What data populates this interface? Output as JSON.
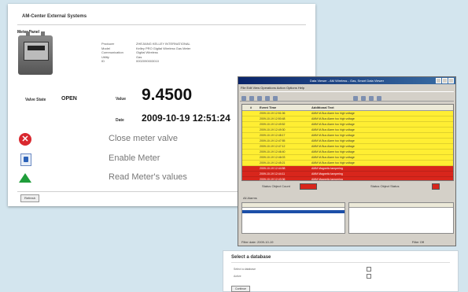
{
  "meter_window": {
    "title": "AM-Center External Systems",
    "panel_title": "Meter Panel",
    "info": [
      {
        "label": "Producer",
        "value": "ZHEJIANG KELLEY INTERNATIONAL"
      },
      {
        "label": "Model",
        "value": "Kelley PRO Gigital Wireless Gas Meter"
      },
      {
        "label": "Communication",
        "value": "Gigital Wireless"
      },
      {
        "label": "Utility",
        "value": "Gas"
      },
      {
        "label": "ID",
        "value": "0002090003010"
      }
    ],
    "valve_state_label": "Valve State",
    "valve_state_value": "OPEN",
    "value_label": "Value",
    "value": "9.4500",
    "date_label": "Date",
    "date_value": "2009-10-19 12:51:24",
    "actions": [
      {
        "label": "Close meter valve",
        "icon": "close-valve-icon"
      },
      {
        "label": "Enable Meter",
        "icon": "enable-meter-icon"
      },
      {
        "label": "Read Meter's values",
        "icon": "read-values-icon"
      }
    ],
    "refresh_label": "Refresh"
  },
  "log_window": {
    "title": "Data Viewer - AM Wireless - Gas, Smart Data Viewer",
    "menu": "File  Edit  View  Operations  Action  Options  Help",
    "columns": [
      "#",
      "Event Time",
      "Additional Text"
    ],
    "rows": [
      {
        "time": "2009-10-19 12:51:06",
        "text": "AMM M-Bus Alarm too high voltage",
        "color": "y"
      },
      {
        "time": "2009-10-19 12:50:48",
        "text": "AMM M-Bus Alarm too high voltage",
        "color": "y"
      },
      {
        "time": "2009-10-19 12:49:52",
        "text": "AMM M-Bus Alarm too high voltage",
        "color": "y"
      },
      {
        "time": "2009-10-19 12:49:30",
        "text": "AMM M-Bus Alarm too high voltage",
        "color": "y"
      },
      {
        "time": "2009-10-19 12:48:17",
        "text": "AMM M-Bus Alarm too high voltage",
        "color": "y"
      },
      {
        "time": "2009-10-19 12:47:55",
        "text": "AMM M-Bus Alarm too high voltage",
        "color": "y"
      },
      {
        "time": "2009-10-19 12:47:12",
        "text": "AMM M-Bus Alarm too high voltage",
        "color": "y"
      },
      {
        "time": "2009-10-19 12:46:40",
        "text": "AMM M-Bus Alarm too high voltage",
        "color": "y"
      },
      {
        "time": "2009-10-19 12:46:03",
        "text": "AMM M-Bus Alarm too high voltage",
        "color": "y"
      },
      {
        "time": "2009-10-19 12:45:21",
        "text": "AMM M-Bus Alarm too high voltage",
        "color": "y"
      },
      {
        "time": "2009-10-19 12:44:58",
        "text": "AMM Magnetic tampering",
        "color": "r"
      },
      {
        "time": "2009-10-19 12:44:11",
        "text": "AMM Magnetic tampering",
        "color": "r"
      },
      {
        "time": "2009-10-19 12:43:36",
        "text": "AMM Magnetic tampering",
        "color": "r"
      },
      {
        "time": "",
        "text": "",
        "color": "w"
      }
    ],
    "status_left_label": "Status Object Count",
    "status_right_label": "Status Object Status",
    "tabs": "All Alarms",
    "status_bar_left": "Filter date: 2009-10-19",
    "status_bar_right": "Filter Off"
  },
  "db_window": {
    "title": "Select a database",
    "fields": [
      "Select a database",
      "Active"
    ],
    "button_label": "Continue"
  }
}
